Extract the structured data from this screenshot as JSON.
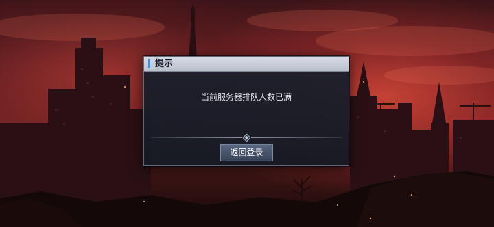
{
  "dialog": {
    "title": "提示",
    "message": "当前服务器排队人数已满",
    "return_button_label": "返回登录"
  },
  "colors": {
    "accent": "#3a8fe6",
    "dialog_bg": "#1c202c",
    "button_bg": "#4b586f",
    "sky_red": "#8a2c28"
  },
  "icons": [
    "diamond-divider-icon"
  ]
}
